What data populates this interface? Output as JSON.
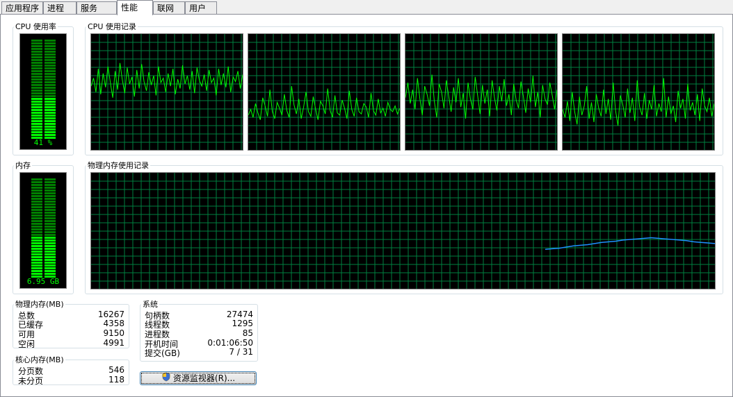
{
  "tabs": [
    {
      "label": "应用程序"
    },
    {
      "label": "进程"
    },
    {
      "label": "服务"
    },
    {
      "label": "性能"
    },
    {
      "label": "联网"
    },
    {
      "label": "用户"
    }
  ],
  "cpu": {
    "title": "CPU 使用率",
    "value_label": "41 %",
    "usage_fraction": 0.41,
    "history_title": "CPU 使用记录",
    "cores": [
      {
        "values": [
          55,
          62,
          50,
          70,
          48,
          66,
          54,
          72,
          58,
          45,
          68,
          52,
          75,
          60,
          49,
          71,
          57,
          63,
          46,
          69,
          53,
          74,
          59,
          51,
          67,
          56,
          64,
          47,
          72,
          58,
          62,
          50,
          66,
          55,
          70,
          48,
          61,
          53,
          73,
          57,
          64,
          52,
          68,
          49,
          71,
          60,
          55,
          65,
          51,
          69,
          58,
          62,
          47,
          70,
          56,
          66,
          54,
          72,
          50,
          63,
          59,
          68,
          53,
          65
        ]
      },
      {
        "values": [
          30,
          35,
          28,
          40,
          32,
          26,
          45,
          38,
          29,
          52,
          33,
          27,
          41,
          36,
          30,
          48,
          34,
          28,
          55,
          39,
          31,
          44,
          27,
          37,
          50,
          33,
          29,
          46,
          35,
          26,
          42,
          38,
          31,
          53,
          34,
          28,
          47,
          32,
          30,
          43,
          36,
          27,
          51,
          35,
          29,
          45,
          33,
          31,
          40,
          37,
          28,
          49,
          34,
          30,
          44,
          32,
          36,
          29,
          41,
          35,
          33,
          38,
          31,
          36
        ]
      },
      {
        "values": [
          45,
          58,
          40,
          52,
          35,
          62,
          44,
          30,
          55,
          48,
          38,
          65,
          42,
          28,
          57,
          50,
          36,
          60,
          46,
          33,
          54,
          41,
          62,
          37,
          49,
          27,
          58,
          44,
          35,
          63,
          47,
          31,
          56,
          40,
          52,
          29,
          60,
          45,
          34,
          55,
          42,
          61,
          38,
          48,
          30,
          57,
          43,
          36,
          59,
          46,
          32,
          53,
          41,
          64,
          37,
          50,
          28,
          56,
          44,
          39,
          58,
          47,
          35,
          52
        ]
      },
      {
        "values": [
          35,
          28,
          42,
          25,
          50,
          33,
          22,
          46,
          30,
          38,
          55,
          27,
          41,
          24,
          48,
          36,
          29,
          52,
          31,
          44,
          26,
          58,
          34,
          21,
          47,
          39,
          28,
          53,
          32,
          45,
          25,
          60,
          37,
          30,
          49,
          27,
          43,
          35,
          56,
          29,
          40,
          33,
          62,
          28,
          46,
          31,
          38,
          24,
          51,
          36,
          44,
          27,
          57,
          34,
          41,
          30,
          48,
          25,
          53,
          38,
          33,
          45,
          29,
          40
        ]
      }
    ]
  },
  "memory": {
    "title": "内存",
    "value_label": "6.95 GB",
    "usage_fraction": 0.43,
    "history_title": "物理内存使用记录",
    "history": [
      34,
      34.5,
      35,
      36,
      37,
      37.5,
      38,
      39,
      40,
      40.5,
      41,
      42,
      42.5,
      43,
      43.5,
      44,
      43.5,
      43,
      42.5,
      42,
      41.5,
      40.5,
      40,
      39.5,
      39
    ]
  },
  "physical_memory": {
    "title": "物理内存(MB)",
    "rows": [
      {
        "label": "总数",
        "value": "16267"
      },
      {
        "label": "已缓存",
        "value": "4358"
      },
      {
        "label": "可用",
        "value": "9150"
      },
      {
        "label": "空闲",
        "value": "4991"
      }
    ]
  },
  "kernel_memory": {
    "title": "核心内存(MB)",
    "rows": [
      {
        "label": "分页数",
        "value": "546"
      },
      {
        "label": "未分页",
        "value": "118"
      }
    ]
  },
  "system": {
    "title": "系统",
    "rows": [
      {
        "label": "句柄数",
        "value": "27474"
      },
      {
        "label": "线程数",
        "value": "1295"
      },
      {
        "label": "进程数",
        "value": "85"
      },
      {
        "label": "开机时间",
        "value": "0:01:06:50"
      },
      {
        "label": "提交(GB)",
        "value": "7 / 31"
      }
    ]
  },
  "resource_monitor_button": "资源监视器(R)...",
  "colors": {
    "grid": "#008040",
    "line": "#00ff00",
    "mem_line": "#1e90ff",
    "meter_on": "#00ff00",
    "meter_off": "#008000"
  }
}
